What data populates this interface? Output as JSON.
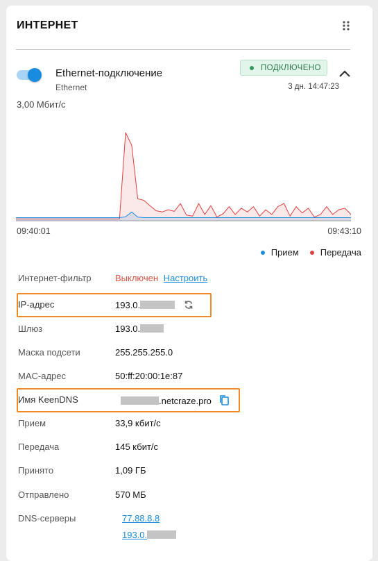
{
  "widget": {
    "title": "ИНТЕРНЕТ",
    "menu_icon": "kebab-grid-icon"
  },
  "connection": {
    "enabled": true,
    "name": "Ethernet-подключение",
    "type": "Ethernet",
    "status": "ПОДКЛЮЧЕНО",
    "uptime": "3 дн. 14:47:23"
  },
  "chart_data": {
    "type": "area",
    "speed_label": "3,00 Мбит/с",
    "time_start": "09:40:01",
    "time_end": "09:43:10",
    "ylim": [
      0,
      3.0
    ],
    "series": [
      {
        "name": "Прием",
        "color": "#1a8ce0",
        "values": [
          0.1,
          0.1,
          0.1,
          0.1,
          0.1,
          0.1,
          0.1,
          0.1,
          0.1,
          0.1,
          0.1,
          0.1,
          0.1,
          0.1,
          0.1,
          0.1,
          0.1,
          0.1,
          0.13,
          0.28,
          0.12,
          0.1,
          0.1,
          0.1,
          0.1,
          0.1,
          0.1,
          0.1,
          0.1,
          0.1,
          0.1,
          0.1,
          0.1,
          0.1,
          0.1,
          0.1,
          0.1,
          0.1,
          0.1,
          0.1,
          0.1,
          0.1,
          0.1,
          0.1,
          0.1,
          0.1,
          0.1,
          0.1,
          0.1,
          0.1,
          0.1,
          0.1,
          0.1,
          0.1,
          0.1,
          0.1
        ]
      },
      {
        "name": "Передача",
        "color": "#e0403f",
        "values": [
          0.06,
          0.06,
          0.06,
          0.06,
          0.06,
          0.06,
          0.06,
          0.06,
          0.06,
          0.06,
          0.06,
          0.06,
          0.06,
          0.06,
          0.06,
          0.06,
          0.06,
          0.06,
          2.8,
          2.4,
          0.7,
          0.65,
          0.48,
          0.32,
          0.28,
          0.35,
          0.3,
          0.55,
          0.18,
          0.15,
          0.55,
          0.2,
          0.48,
          0.12,
          0.22,
          0.45,
          0.2,
          0.4,
          0.28,
          0.45,
          0.15,
          0.35,
          0.2,
          0.45,
          0.55,
          0.15,
          0.45,
          0.25,
          0.4,
          0.12,
          0.2,
          0.45,
          0.2,
          0.35,
          0.4,
          0.2
        ]
      }
    ]
  },
  "legend": {
    "rx": "Прием",
    "tx": "Передача",
    "rx_color": "#1a8ce0",
    "tx_color": "#e0403f"
  },
  "details": {
    "filter_label": "Интернет-фильтр",
    "filter_value": "Выключен",
    "filter_action": "Настроить",
    "ip_label": "IP-адрес",
    "ip_value": "193.0.",
    "gateway_label": "Шлюз",
    "gateway_value": "193.0.",
    "mask_label": "Маска подсети",
    "mask_value": "255.255.255.0",
    "mac_label": "MAC-адрес",
    "mac_value": "50:ff:20:00:1e:87",
    "keendns_label": "Имя KeenDNS",
    "keendns_value": ".netcraze.pro",
    "rx_label": "Прием",
    "rx_value": "33,9 кбит/с",
    "tx_label": "Передача",
    "tx_value": "145 кбит/с",
    "received_label": "Принято",
    "received_value": "1,09 ГБ",
    "sent_label": "Отправлено",
    "sent_value": "570 МБ",
    "dns_label": "DNS-серверы",
    "dns_1": "77.88.8.8",
    "dns_2": "193.0."
  }
}
